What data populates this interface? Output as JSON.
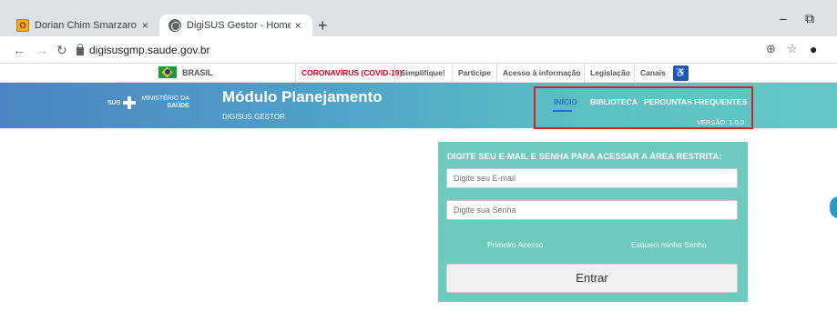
{
  "browser": {
    "tabs": [
      {
        "label": "Dorian Chim Smarzaro - Outlook",
        "icon": "outlook-icon",
        "active": false
      },
      {
        "label": "DigiSUS Gestor - Home",
        "icon": "globe-icon",
        "active": true
      }
    ],
    "new_tab_symbol": "+",
    "tab_close_symbol": "×",
    "url": "digisusgmp.saude.gov.br",
    "window_controls": {
      "minimize": "–",
      "restore": "⧉"
    }
  },
  "gov_bar": {
    "brasil_label": "BRASIL",
    "links": [
      {
        "label": "CORONAVÍRUS (COVID-19)",
        "color": "#d6001c"
      },
      {
        "label": "Simplifique!"
      },
      {
        "label": "Participe"
      },
      {
        "label": "Acesso à informação"
      },
      {
        "label": "Legislação"
      },
      {
        "label": "Canais"
      }
    ]
  },
  "header": {
    "logo_sus": "SUS",
    "logo_line1": "MINISTÉRIO DA",
    "logo_line2": "SAÚDE",
    "title": "Módulo Planejamento",
    "subtitle": "DIGISUS GESTOR",
    "nav": [
      {
        "label": "INÍCIO",
        "active": true
      },
      {
        "label": "BIBLIOTECA"
      },
      {
        "label": "PERGUNTAS FREQUENTES"
      }
    ],
    "version": "VERSÃO: 1.0.0",
    "highlight_color": "#d91f26",
    "accent_color": "#2b6fc0"
  },
  "login": {
    "title": "DIGITE SEU E-MAIL E SENHA PARA ACESSAR A ÁREA RESTRITA:",
    "email_placeholder": "Digite seu E-mail",
    "password_placeholder": "Digite sua Senha",
    "first_access": "Primeiro Acesso",
    "forgot_password": "Esqueci minha Senha",
    "submit": "Entrar",
    "panel_color": "#6ccbbd"
  }
}
